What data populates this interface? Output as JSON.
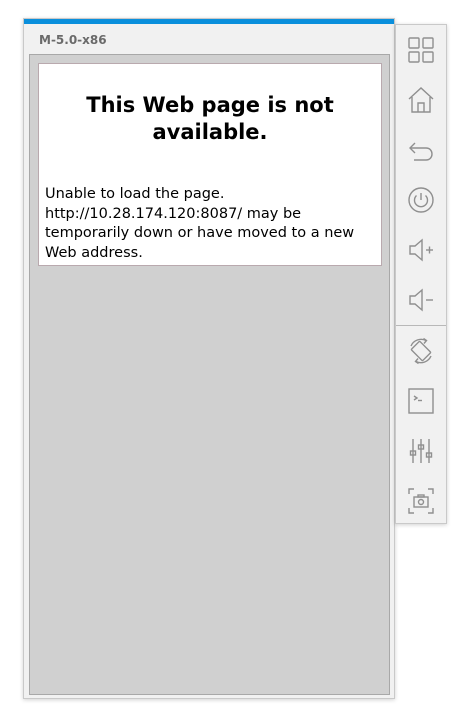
{
  "window": {
    "title": "M-5.0-x86"
  },
  "colors": {
    "accent": "#0a8fdc",
    "toolbar_icon": "#8f8f8f",
    "screen_background": "#d0d0d0"
  },
  "browser_error": {
    "title_line_1": "This Web page is not",
    "title_line_2": "available.",
    "message_lines": [
      "Unable to load the page.",
      "http://10.28.174.120:8087/ may be",
      "temporarily down or have moved to a new",
      "Web address."
    ]
  },
  "toolbar": {
    "items": [
      {
        "name": "app-switch",
        "icon": "grid-icon"
      },
      {
        "name": "home",
        "icon": "home-icon"
      },
      {
        "name": "back",
        "icon": "back-arrow-icon"
      },
      {
        "name": "power",
        "icon": "power-icon"
      },
      {
        "name": "volume-up",
        "icon": "volume-up-icon"
      },
      {
        "name": "volume-down",
        "icon": "volume-down-icon"
      },
      {
        "name": "rotate",
        "icon": "rotate-icon"
      },
      {
        "name": "console",
        "icon": "terminal-icon"
      },
      {
        "name": "settings",
        "icon": "sliders-icon"
      },
      {
        "name": "screenshot",
        "icon": "camera-icon"
      }
    ]
  }
}
